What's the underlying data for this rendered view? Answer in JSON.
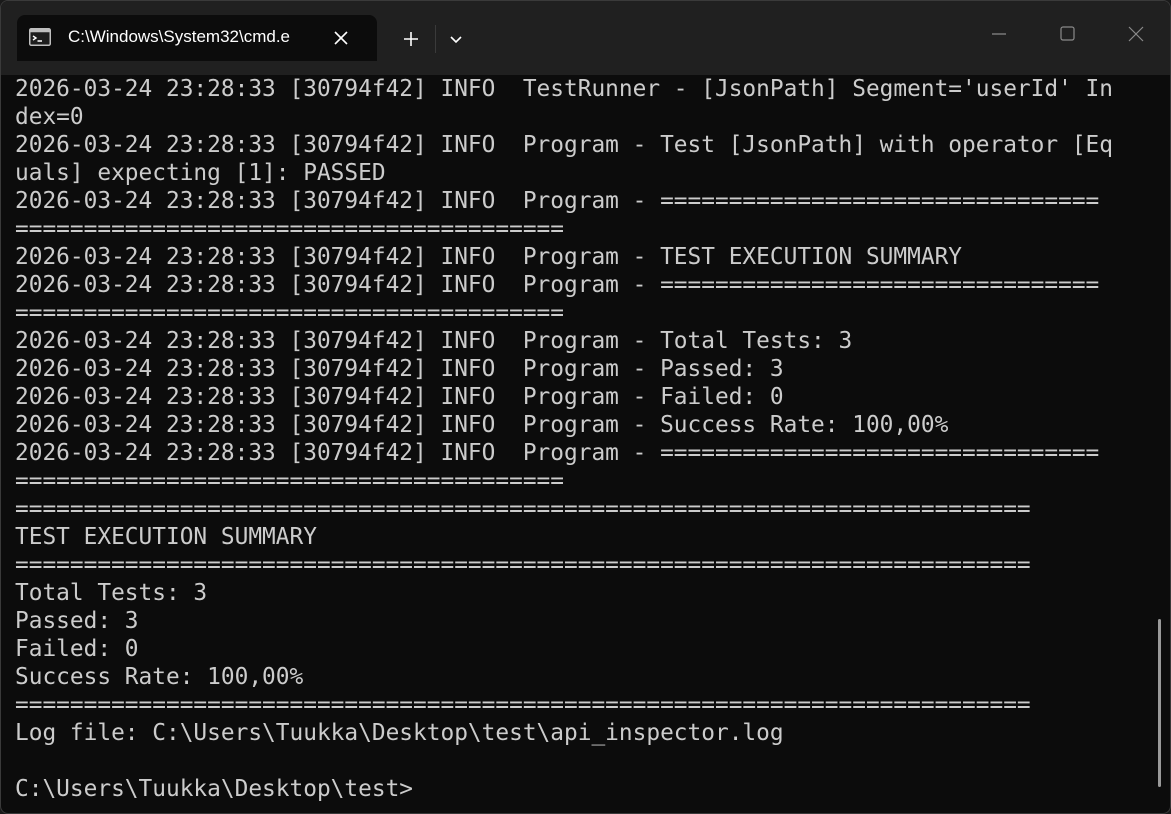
{
  "window": {
    "tab_title": "C:\\Windows\\System32\\cmd.e",
    "icons": {
      "tab": "command-prompt-icon",
      "close_tab": "close-icon",
      "new_tab": "plus-icon",
      "dropdown": "chevron-down-icon",
      "minimize": "minimize-icon",
      "maximize": "maximize-icon",
      "close_window": "close-icon"
    },
    "colors": {
      "titlebar": "#202020",
      "terminal_background": "#0c0c0c",
      "terminal_text": "#cccccc"
    }
  },
  "terminal": {
    "lines": [
      "2026-03-24 23:28:33 [30794f42] INFO  TestRunner - [JsonPath] Segment='userId' In",
      "dex=0",
      "2026-03-24 23:28:33 [30794f42] INFO  Program - Test [JsonPath] with operator [Eq",
      "uals] expecting [1]: PASSED",
      "2026-03-24 23:28:33 [30794f42] INFO  Program - ================================",
      "========================================",
      "2026-03-24 23:28:33 [30794f42] INFO  Program - TEST EXECUTION SUMMARY",
      "2026-03-24 23:28:33 [30794f42] INFO  Program - ================================",
      "========================================",
      "2026-03-24 23:28:33 [30794f42] INFO  Program - Total Tests: 3",
      "2026-03-24 23:28:33 [30794f42] INFO  Program - Passed: 3",
      "2026-03-24 23:28:33 [30794f42] INFO  Program - Failed: 0",
      "2026-03-24 23:28:33 [30794f42] INFO  Program - Success Rate: 100,00%",
      "2026-03-24 23:28:33 [30794f42] INFO  Program - ================================",
      "========================================",
      "==========================================================================",
      "TEST EXECUTION SUMMARY",
      "==========================================================================",
      "Total Tests: 3",
      "Passed: 3",
      "Failed: 0",
      "Success Rate: 100,00%",
      "==========================================================================",
      "Log file: C:\\Users\\Tuukka\\Desktop\\test\\api_inspector.log",
      "",
      "C:\\Users\\Tuukka\\Desktop\\test>"
    ]
  }
}
